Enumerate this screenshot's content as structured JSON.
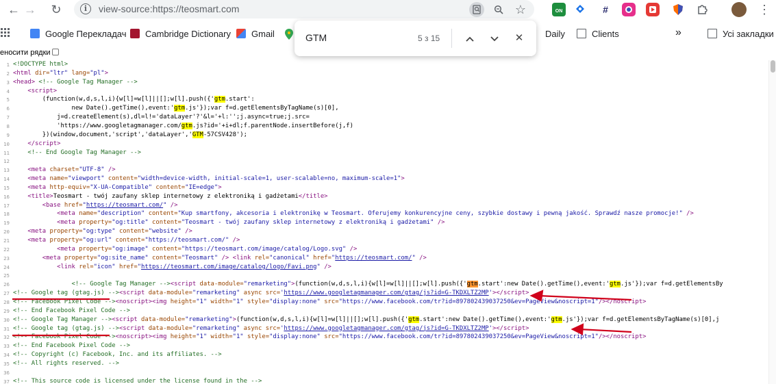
{
  "toolbar": {
    "back_icon": "←",
    "forward_icon": "→",
    "reload_icon": "↻",
    "url": "view-source:https://teosmart.com",
    "search_in_page_icon": "search-page-icon",
    "zoom_icon": "zoom-icon",
    "star_icon": "☆",
    "ext_on_label": "ON",
    "menu_icon": "⋮"
  },
  "bookmarks": {
    "apps_icon": "apps-icon",
    "items": [
      {
        "label": "Google Перекладач"
      },
      {
        "label": "Cambridge Dictionary"
      },
      {
        "label": "Gmail"
      },
      {
        "label": "Daily"
      },
      {
        "label": "Clients"
      }
    ],
    "more": "»",
    "all_bookmarks": "Усі закладки"
  },
  "wrap_lines_label": "еносити рядки",
  "find_bar": {
    "query": "GTM",
    "count": "5 з 15",
    "up_icon": "^",
    "down_icon": "v",
    "close_icon": "✕"
  },
  "source_lines": [
    {
      "n": "1",
      "html": "<span class='cmt'>&lt;!DOCTYPE html&gt;</span>"
    },
    {
      "n": "2",
      "html": "<span class='tag'>&lt;html </span><span class='attr'>dir=</span><span class='val'>\"ltr\"</span><span class='attr'> lang=</span><span class='val'>\"pl\"</span><span class='tag'>&gt;</span>"
    },
    {
      "n": "3",
      "html": "<span class='tag'>&lt;head&gt;</span> <span class='cmt'>&lt;!-- Google Tag Manager --&gt;</span>"
    },
    {
      "n": "4",
      "html": "    <span class='tag'>&lt;script&gt;</span>"
    },
    {
      "n": "5",
      "html": "        (function(w,d,s,l,i){w[l]=w[l]||[];w[l].push({'<span class='hl'>gtm</span>.start':"
    },
    {
      "n": "6",
      "html": "                new Date().getTime(),event:'<span class='hl'>gtm</span>.js'});var f=d.getElementsByTagName(s)[0],"
    },
    {
      "n": "7",
      "html": "            j=d.createElement(s),dl=l!='dataLayer'?'&amp;l='+l:'';j.async=true;j.src="
    },
    {
      "n": "8",
      "html": "            'https://www.googletagmanager.com/<span class='hl'>gtm</span>.js?id='+i+dl;f.parentNode.insertBefore(j,f)"
    },
    {
      "n": "9",
      "html": "        })(window,document,'script','dataLayer','<span class='hl'>GTM</span>-57CSV428');"
    },
    {
      "n": "10",
      "html": "    <span class='tag'>&lt;/script&gt;</span>"
    },
    {
      "n": "11",
      "html": "    <span class='cmt'>&lt;!-- End Google Tag Manager --&gt;</span>"
    },
    {
      "n": "12",
      "html": ""
    },
    {
      "n": "13",
      "html": "    <span class='tag'>&lt;meta </span><span class='attr'>charset=</span><span class='val'>\"UTF-8\"</span><span class='tag'> /&gt;</span>"
    },
    {
      "n": "14",
      "html": "    <span class='tag'>&lt;meta </span><span class='attr'>name=</span><span class='val'>\"viewport\"</span><span class='attr'> content=</span><span class='val'>\"width=device-width, initial-scale=1, user-scalable=no, maximum-scale=1\"</span><span class='tag'>&gt;</span>"
    },
    {
      "n": "15",
      "html": "    <span class='tag'>&lt;meta </span><span class='attr'>http-equiv=</span><span class='val'>\"X-UA-Compatible\"</span><span class='attr'> content=</span><span class='val'>\"IE=edge\"</span><span class='tag'>&gt;</span>"
    },
    {
      "n": "16",
      "html": "    <span class='tag'>&lt;title&gt;</span>Teosmart - twój zaufany sklep internetowy z elektroniką i gadżetami<span class='tag'>&lt;/title&gt;</span>"
    },
    {
      "n": "17",
      "html": "        <span class='tag'>&lt;base </span><span class='attr'>href=</span><span class='val'>\"<span class='lnk'>https://teosmart.com/</span>\"</span><span class='tag'> /&gt;</span>"
    },
    {
      "n": "18",
      "html": "            <span class='tag'>&lt;meta </span><span class='attr'>name=</span><span class='val'>\"description\"</span><span class='attr'> content=</span><span class='val'>\"Kup smartfony, akcesoria i elektronikę w Teosmart. Oferujemy konkurencyjne ceny, szybkie dostawy i pewną jakość. Sprawdź nasze promocje!\"</span><span class='tag'> /&gt;</span>"
    },
    {
      "n": "19",
      "html": "            <span class='tag'>&lt;meta </span><span class='attr'>property=</span><span class='val'>\"og:title\"</span><span class='attr'> content=</span><span class='val'>\"Teosmart - twój zaufany sklep internetowy z elektroniką i gadżetami\"</span><span class='tag'> /&gt;</span>"
    },
    {
      "n": "20",
      "html": "    <span class='tag'>&lt;meta </span><span class='attr'>property=</span><span class='val'>\"og:type\"</span><span class='attr'> content=</span><span class='val'>\"website\"</span><span class='tag'> /&gt;</span>"
    },
    {
      "n": "21",
      "html": "    <span class='tag'>&lt;meta </span><span class='attr'>property=</span><span class='val'>\"og:url\"</span><span class='attr'> content=</span><span class='val'>\"https://teosmart.com/\"</span><span class='tag'> /&gt;</span>"
    },
    {
      "n": "22",
      "html": "            <span class='tag'>&lt;meta </span><span class='attr'>property=</span><span class='val'>\"og:image\"</span><span class='attr'> content=</span><span class='val'>\"https://teosmart.com/image/catalog/Logo.svg\"</span><span class='tag'> /&gt;</span>"
    },
    {
      "n": "23",
      "html": "        <span class='tag'>&lt;meta </span><span class='attr'>property=</span><span class='val'>\"og:site_name\"</span><span class='attr'> content=</span><span class='val'>\"Teosmart\"</span><span class='tag'> /&gt;</span> <span class='tag'>&lt;link </span><span class='attr'>rel=</span><span class='val'>\"canonical\"</span><span class='attr'> href=</span><span class='val'>\"<span class='lnk'>https://teosmart.com/</span>\"</span><span class='tag'> /&gt;</span>"
    },
    {
      "n": "24",
      "html": "            <span class='tag'>&lt;link </span><span class='attr'>rel=</span><span class='val'>\"icon\"</span><span class='attr'> href=</span><span class='val'>\"<span class='lnk'>https://teosmart.com/image/catalog/logo/Favi.png</span>\"</span><span class='tag'> /&gt;</span>"
    },
    {
      "n": "25",
      "html": ""
    },
    {
      "n": "26",
      "html": "                <span class='cmt'>&lt;!-- Google Tag Manager --&gt;</span><span class='tag'>&lt;script </span><span class='attr'>data-module=</span><span class='val'>\"remarketing\"</span><span class='tag'>&gt;</span>(function(w,d,s,l,i){w[l]=w[l]||[];w[l].push({'<span class='hl-cur'>gtm</span>.start':new Date().getTime(),event:'<span class='hl'>gtm</span>.js'});var f=d.getElementsBy"
    },
    {
      "n": "27",
      "html": "<span class='cmt'>&lt;!-- Google tag (gtag.js) --&gt;</span><span class='tag'>&lt;script </span><span class='attr'>data-module=</span><span class='val'>\"remarketing\"</span><span class='attr'> async src=</span><span class='val'>'<span class='lnk'>https://www.googletagmanager.com/gtag/js?id=G-TKDXLTZ2MP</span>'</span><span class='tag'>&gt;&lt;/script&gt;</span>"
    },
    {
      "n": "28",
      "html": "<span class='cmt'>&lt;!-- Facebook Pixel Code --&gt;</span><span class='tag'>&lt;noscript&gt;</span><span class='tag'>&lt;img </span><span class='attr'>height=</span><span class='val'>\"1\"</span><span class='attr'> width=</span><span class='val'>\"1\"</span><span class='attr'> style=</span><span class='val'>\"display:none\"</span><span class='attr'> src=</span><span class='val'>\"https://www.facebook.com/tr?id=897802439037250&amp;ev=PageView&amp;noscript=1\"</span><span class='tag'>/&gt;&lt;/noscript&gt;</span>"
    },
    {
      "n": "29",
      "html": "<span class='cmt'>&lt;!-- End Facebook Pixel Code --&gt;</span>"
    },
    {
      "n": "30",
      "html": "<span class='cmt'>&lt;!-- Google Tag Manager --&gt;</span><span class='tag'>&lt;script </span><span class='attr'>data-module=</span><span class='val'>\"remarketing\"</span><span class='tag'>&gt;</span>(function(w,d,s,l,i){w[l]=w[l]||[];w[l].push({'<span class='hl'>gtm</span>.start':new Date().getTime(),event:'<span class='hl'>gtm</span>.js'});var f=d.getElementsByTagName(s)[0],j"
    },
    {
      "n": "31",
      "html": "<span class='cmt'>&lt;!-- Google tag (gtag.js) --&gt;</span><span class='tag'>&lt;script </span><span class='attr'>data-module=</span><span class='val'>\"remarketing\"</span><span class='attr'> async src=</span><span class='val'>'<span class='lnk'>https://www.googletagmanager.com/gtag/js?id=G-TKDXLTZ2MP</span>'</span><span class='tag'>&gt;&lt;/script&gt;</span>"
    },
    {
      "n": "32",
      "html": "<span class='cmt'>&lt;!-- Facebook Pixel Code --&gt;</span><span class='tag'>&lt;noscript&gt;</span><span class='tag'>&lt;img </span><span class='attr'>height=</span><span class='val'>\"1\"</span><span class='attr'> width=</span><span class='val'>\"1\"</span><span class='attr'> style=</span><span class='val'>\"display:none\"</span><span class='attr'> src=</span><span class='val'>\"https://www.facebook.com/tr?id=897802439037250&amp;ev=PageView&amp;noscript=1\"</span><span class='tag'>/&gt;&lt;/noscript&gt;</span>"
    },
    {
      "n": "33",
      "html": "<span class='cmt'>&lt;!-- End Facebook Pixel Code --&gt;</span>"
    },
    {
      "n": "34",
      "html": "<span class='cmt'>&lt;!-- Copyright (c) Facebook, Inc. and its affiliates. --&gt;</span>"
    },
    {
      "n": "35",
      "html": "<span class='cmt'>&lt;!-- All rights reserved. --&gt;</span>"
    },
    {
      "n": "36",
      "html": ""
    },
    {
      "n": "37",
      "html": "<span class='cmt'>&lt;!-- This source code is licensed under the license found in the --&gt;</span>"
    }
  ],
  "colors": {
    "highlight": "#ffff00",
    "current_highlight": "#ff9632",
    "annotation_red": "#d0021b"
  }
}
